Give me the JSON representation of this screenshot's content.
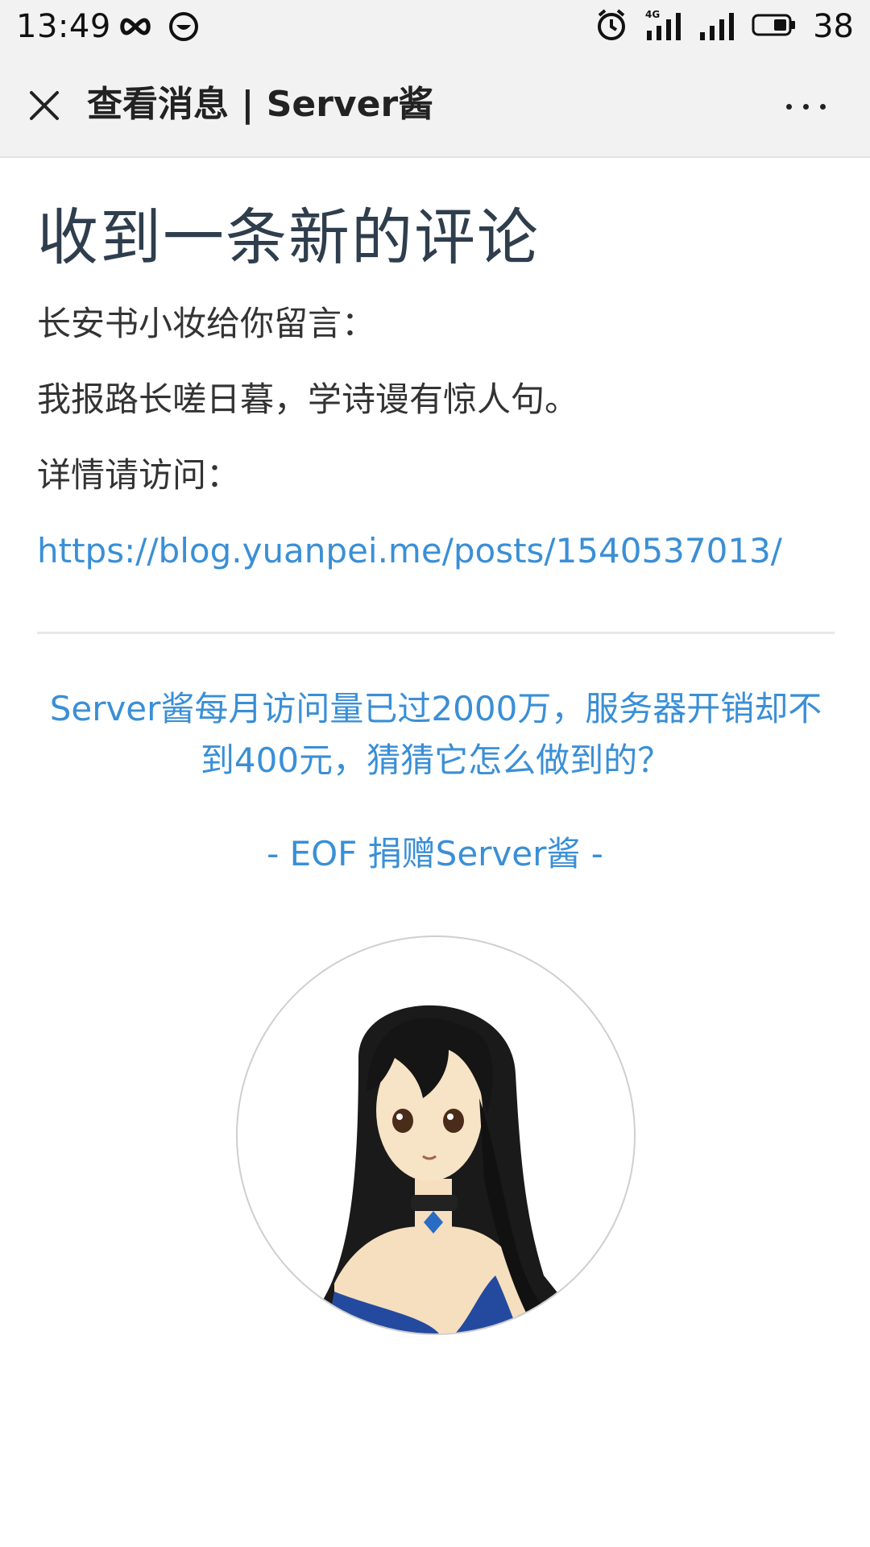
{
  "status_bar": {
    "time": "13:49",
    "battery": "38",
    "network": "4G",
    "icons": [
      "infinity-icon",
      "chat-bubble-icon",
      "alarm-icon",
      "signal-4g-icon",
      "signal-icon",
      "battery-icon"
    ]
  },
  "app_bar": {
    "title": "查看消息 | Server酱",
    "close_icon": "close-icon",
    "more_icon": "more-icon"
  },
  "message": {
    "heading": "收到一条新的评论",
    "line1": "长安书小妆给你留言：",
    "line2": "我报路长嗟日暮，学诗谩有惊人句。",
    "line3": "详情请访问：",
    "link": "https://blog.yuanpei.me/posts/1540537013/"
  },
  "footer": {
    "promo": "Server酱每月访问量已过2000万，服务器开销却不到400元，猜猜它怎么做到的？",
    "eof": "- EOF 捐赠Server酱 -"
  },
  "colors": {
    "accent": "#3a8fd6",
    "heading": "#2f3e4d",
    "text": "#333333",
    "bar": "#f2f2f2"
  }
}
